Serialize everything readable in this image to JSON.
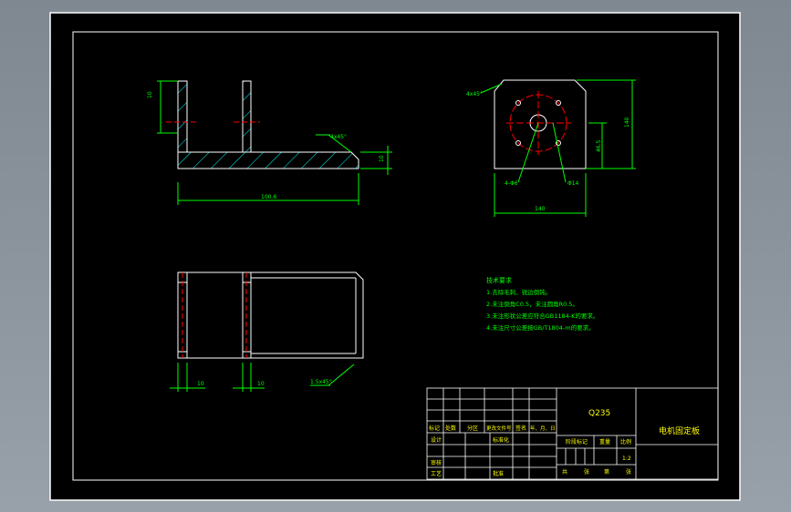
{
  "drawing": {
    "title_block": {
      "material": "Q235",
      "part_name": "电机固定板",
      "labels": {
        "biaoji": "标记",
        "chushu": "处数",
        "fenqu": "分区",
        "gengai": "更改文件号",
        "qianming": "签名",
        "nianyueri": "年、月、日",
        "sheji": "设计",
        "biaozhunhua": "标准化",
        "jieduan": "阶段标记",
        "zhongliang": "重量",
        "bili": "比例",
        "scale_value": "1:2",
        "shenhe": "审核",
        "gongyi": "工艺",
        "pizhun": "批准",
        "gong": "共",
        "zhang1": "张",
        "di": "第",
        "zhang2": "张"
      }
    },
    "tech_requirements": {
      "heading": "技术要求",
      "items": [
        "1.去除毛刺、锐边倒钝。",
        "2.未注倒角C0.5，未注圆角R0.5。",
        "3.未注形状公差应符合GB1184-K的要求。",
        "4.未注尺寸公差按GB/T1804-m的要求。"
      ]
    },
    "dimensions": {
      "front_view": {
        "left_height": "10",
        "bottom_length": "100.6",
        "chamfer_note": "4x45°",
        "right_height": "10"
      },
      "top_view": {
        "chamfer_note": "4x45°",
        "width": "140",
        "right_height": "140",
        "inner_height": "46.5",
        "hole_left": "4-Φ6",
        "hole_right": "Φ14"
      },
      "bottom_view": {
        "dim_left": "10",
        "dim_mid": "10",
        "chamfer_note": "1.5x45°"
      }
    },
    "colors": {
      "line": "#ffffff",
      "dim": "#00ff00",
      "center": "#ff0000",
      "hatch": "#00ffff",
      "text": "#ffff00"
    }
  }
}
